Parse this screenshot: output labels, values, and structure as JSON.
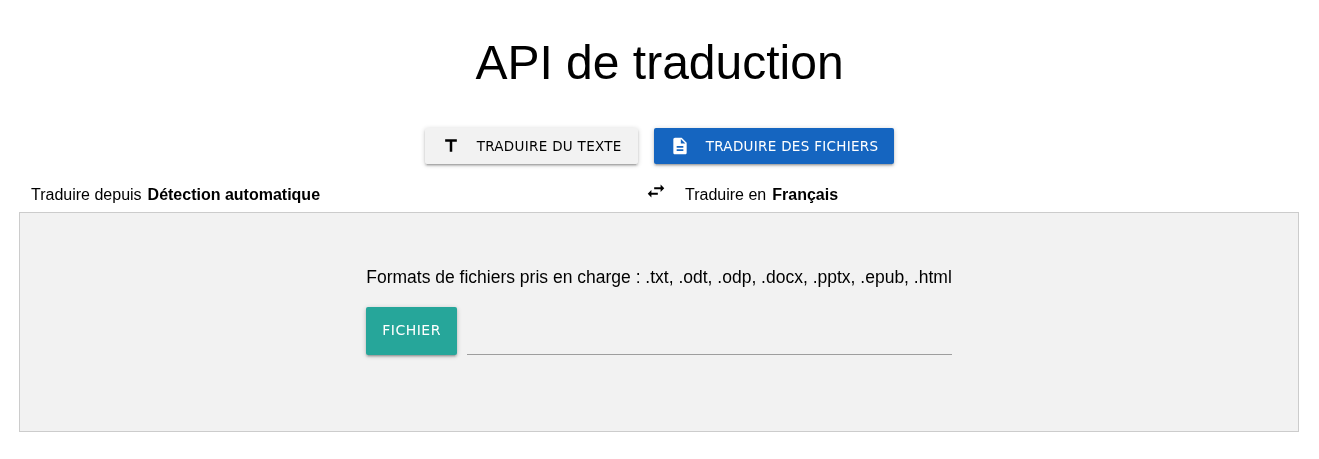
{
  "title": "API de traduction",
  "tabs": [
    {
      "label": "TRADUIRE DU TEXTE",
      "kind": "text",
      "selected": false
    },
    {
      "label": "TRADUIRE DES FICHIERS",
      "kind": "file",
      "selected": true
    }
  ],
  "source": {
    "label": "Traduire depuis",
    "value": "Détection automatique"
  },
  "target": {
    "label": "Traduire en",
    "value": "Français"
  },
  "file_panel": {
    "formats": "Formats de fichiers pris en charge : .txt, .odt, .odp, .docx, .pptx, .epub, .html",
    "button": "FICHIER"
  }
}
